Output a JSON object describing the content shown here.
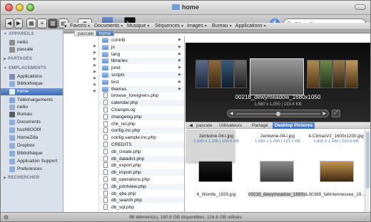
{
  "window": {
    "title": "home"
  },
  "toolbar": {
    "search_placeholder": "Filtrer Par nom",
    "info_label": "i"
  },
  "bookmarks": [
    {
      "label": "Favoris"
    },
    {
      "label": "Documents"
    },
    {
      "label": "Musique"
    },
    {
      "label": "Séquences"
    },
    {
      "label": "Images"
    },
    {
      "label": "Bureau"
    },
    {
      "label": "Applications"
    }
  ],
  "sidebar": {
    "sections": {
      "appareils": "APPAREILS",
      "partages": "PARTAGÉS",
      "emplacements": "EMPLACEMENTS",
      "rechercher": "RECHERCHER"
    },
    "devices": [
      "neilio",
      "pascale"
    ],
    "places": [
      "Applications",
      "Bibliothèque",
      "home",
      "Téléchargements",
      "neilio",
      "Bureau",
      "Documents",
      "hush8OOM",
      "HomeZilla",
      "Dropbox",
      "Bibliothèque",
      "Application Support",
      "Preferences"
    ],
    "selected": "home"
  },
  "breadcrumb": [
    "pascale",
    "home"
  ],
  "column_b": [
    {
      "name": "contrib",
      "type": "folder"
    },
    {
      "name": "js",
      "type": "folder"
    },
    {
      "name": "lang",
      "type": "folder"
    },
    {
      "name": "libraries",
      "type": "folder"
    },
    {
      "name": "pmd",
      "type": "folder"
    },
    {
      "name": "scripts",
      "type": "folder"
    },
    {
      "name": "test",
      "type": "folder"
    },
    {
      "name": "themes",
      "type": "folder"
    },
    {
      "name": "browse_foreigners.php",
      "type": "file"
    },
    {
      "name": "calendar.php",
      "type": "file"
    },
    {
      "name": "ChangeLog",
      "type": "file"
    },
    {
      "name": "changelog.php",
      "type": "file"
    },
    {
      "name": "chk_rel.php",
      "type": "file"
    },
    {
      "name": "config.inc.php",
      "type": "file"
    },
    {
      "name": "config.sample.inc.php",
      "type": "file"
    },
    {
      "name": "CREDITS",
      "type": "file"
    },
    {
      "name": "db_create.php",
      "type": "file"
    },
    {
      "name": "db_datadict.php",
      "type": "file"
    },
    {
      "name": "db_export.php",
      "type": "file"
    },
    {
      "name": "db_import.php",
      "type": "file"
    },
    {
      "name": "db_operations.php",
      "type": "file"
    },
    {
      "name": "db_printview.php",
      "type": "file"
    },
    {
      "name": "db_qbe.php",
      "type": "file"
    },
    {
      "name": "db_search.php",
      "type": "file"
    },
    {
      "name": "db_sql.php",
      "type": "file"
    }
  ],
  "preview": {
    "filename": "00218_dewymeadow_1680x1050",
    "details": "1,680 x 1,050 | 133.4 KB"
  },
  "bottom_tabs": [
    "pascale",
    "Utilisateurs",
    "Partagé",
    "Desktop Pictures"
  ],
  "bottom_tabs_active": "Desktop Pictures",
  "icon_grid": {
    "top_row": [
      {
        "name": "2entwine-04-l.jpg",
        "dims": "1,920 x 1,200 | 103.6 KB"
      },
      {
        "name": "2entwine-04-l.jpg",
        "dims": "1,920 x 1,200 | 133.1 KB"
      },
      {
        "name": "4-ClimaxV2_1600x1200.jpg",
        "dims": "1,600 x 1,200 | 220.0 KB"
      }
    ],
    "bottom_row": [
      {
        "name": "6_Wordle_1920.jpg"
      },
      {
        "name": "00218_dewymeadow_1680x1..."
      },
      {
        "name": "00388_fallintennessee_19..."
      }
    ]
  },
  "status": {
    "text": "98 élément(s), 180.8 GB disponibles, 116.8 GB utilisés"
  },
  "colors": {
    "selection": "#3f6cb5",
    "sidebar_bg": "#dbe1ea",
    "link_blue": "#4a74c9"
  }
}
